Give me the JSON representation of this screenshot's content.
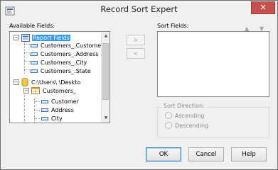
{
  "window": {
    "title": "Record Sort Expert",
    "close_glyph": "✕"
  },
  "available_fields": {
    "label": "Available Fields:",
    "items": [
      {
        "text": "Report Fields",
        "icon": "report-fields-icon",
        "expander": "−",
        "selected": true
      },
      {
        "text": "Customers_.Customer",
        "icon": "field-icon"
      },
      {
        "text": "Customers_.Address",
        "icon": "field-icon"
      },
      {
        "text": "Customers_.City",
        "icon": "field-icon"
      },
      {
        "text": "Customers_.State",
        "icon": "field-icon"
      },
      {
        "text": "C:\\Users\\            \\Deskto",
        "icon": "database-icon",
        "expander": "−"
      },
      {
        "text": "Customers_",
        "icon": "table-icon",
        "expander": "−"
      },
      {
        "text": "Customer",
        "icon": "field-icon"
      },
      {
        "text": "Address",
        "icon": "field-icon"
      },
      {
        "text": "City",
        "icon": "field-icon"
      }
    ]
  },
  "move_buttons": {
    "add": ">",
    "remove": "<"
  },
  "sort_fields": {
    "label": "Sort Fields:",
    "up_glyph": "▲",
    "down_glyph": "▼"
  },
  "sort_direction": {
    "label": "Sort Direction:",
    "options": [
      "Ascending",
      "Descending"
    ]
  },
  "buttons": {
    "ok": "OK",
    "cancel": "Cancel",
    "help": "Help"
  },
  "scrollbar": {
    "up_glyph": "▲",
    "down_glyph": "▼"
  },
  "colors": {
    "selection": "#3399ff",
    "close_button": "#c7504f"
  }
}
